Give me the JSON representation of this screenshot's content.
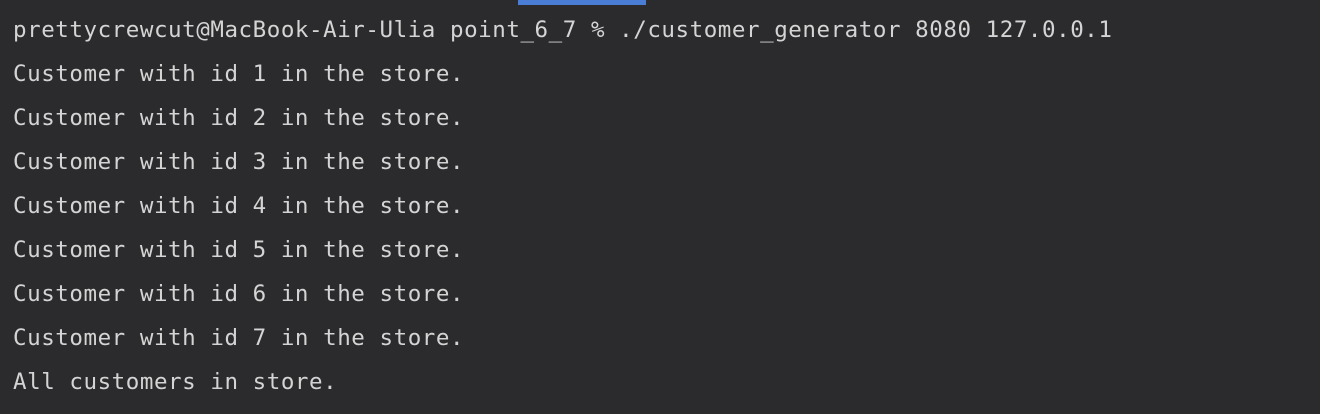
{
  "terminal": {
    "command_line": "prettycrewcut@MacBook-Air-Ulia point_6_7 % ./customer_generator 8080 127.0.0.1",
    "output_lines": [
      "Customer with id 1 in the store.",
      "Customer with id 2 in the store.",
      "Customer with id 3 in the store.",
      "Customer with id 4 in the store.",
      "Customer with id 5 in the store.",
      "Customer with id 6 in the store.",
      "Customer with id 7 in the store.",
      "All customers in store."
    ]
  },
  "colors": {
    "background": "#2b2b2d",
    "text": "#d4d4d4",
    "tab_indicator": "#4a7dd6"
  }
}
